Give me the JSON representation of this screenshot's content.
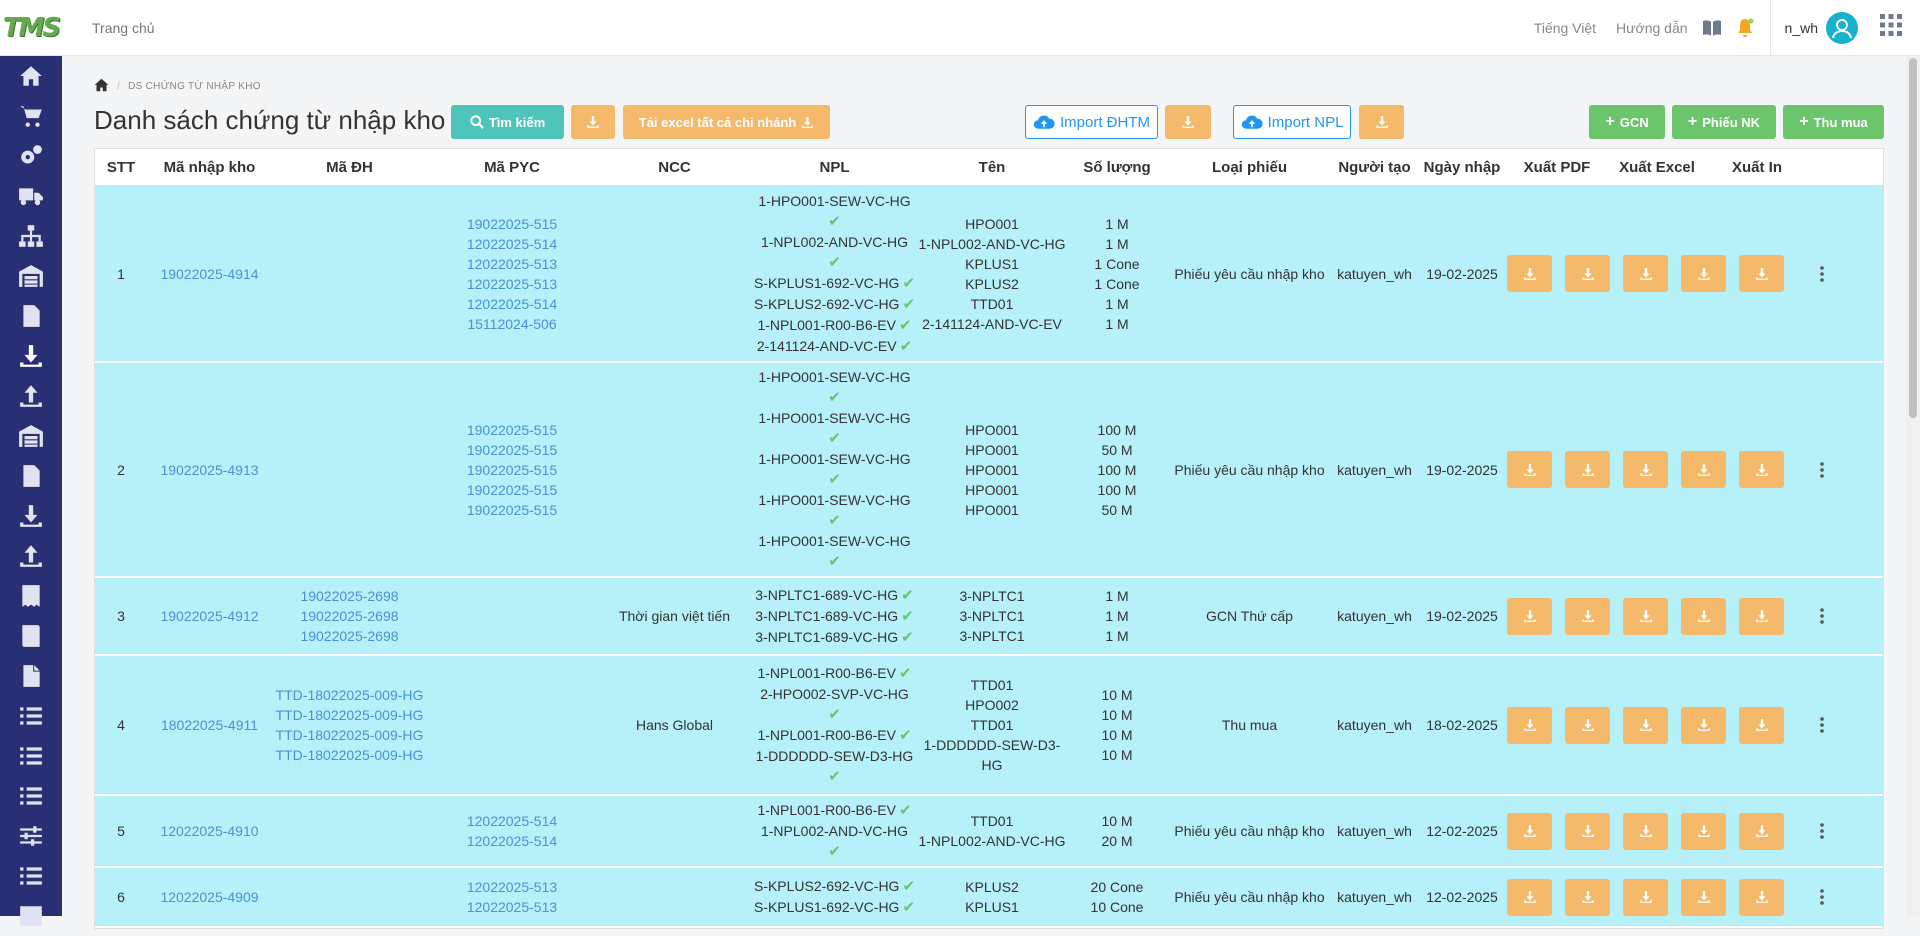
{
  "header": {
    "home": "Trang chủ",
    "language": "Tiếng Việt",
    "guide": "Hướng dẫn",
    "username": "n_wh"
  },
  "breadcrumb": {
    "current": "DS CHỨNG TỪ NHẬP KHO"
  },
  "page": {
    "title": "Danh sách chứng từ nhập kho",
    "search": "Tìm kiếm",
    "excel_all": "Tải excel tất cả chi nhánh",
    "import_dhtm": "Import ĐHTM",
    "import_npl": "Import NPL",
    "gcn": "GCN",
    "phieu_nk": "Phiếu NK",
    "thu_mua": "Thu mua"
  },
  "columns": [
    "STT",
    "Mã nhập kho",
    "Mã ĐH",
    "Mã PYC",
    "NCC",
    "NPL",
    "Tên",
    "Số lượng",
    "Loại phiếu",
    "Người tạo",
    "Ngày nhập",
    "Xuất PDF",
    "Xuất Excel",
    "Xuất In"
  ],
  "rows": [
    {
      "stt": "1",
      "ma_nk": "19022025-4914",
      "ma_dh": [],
      "ma_pyc": [
        "19022025-515",
        "12022025-514",
        "12022025-513",
        "12022025-513",
        "12022025-514",
        "15112024-506"
      ],
      "ncc": "",
      "npl": [
        [
          "1-HPO001-SEW-VC-HG",
          ""
        ],
        [
          "✔",
          ""
        ],
        [
          "1-NPL002-AND-VC-HG",
          ""
        ],
        [
          "✔",
          ""
        ],
        [
          "S-KPLUS1-692-VC-HG",
          "✔"
        ],
        [
          "S-KPLUS2-692-VC-HG",
          "✔"
        ],
        [
          "1-NPL001-R00-B6-EV",
          "✔"
        ],
        [
          "2-141124-AND-VC-EV",
          "✔"
        ]
      ],
      "ten": [
        "HPO001",
        "1-NPL002-AND-VC-HG",
        "KPLUS1",
        "KPLUS2",
        "TTD01",
        "2-141124-AND-VC-EV"
      ],
      "sl": [
        "1 M",
        "1 M",
        "1 Cone",
        "1 Cone",
        "1 M",
        "1 M"
      ],
      "loai": "Phiếu yêu cầu nhập kho",
      "nguoi": "katuyen_wh",
      "ngay": "19-02-2025"
    },
    {
      "stt": "2",
      "ma_nk": "19022025-4913",
      "ma_dh": [],
      "ma_pyc": [
        "19022025-515",
        "19022025-515",
        "19022025-515",
        "19022025-515",
        "19022025-515"
      ],
      "ncc": "",
      "npl": [
        [
          "1-HPO001-SEW-VC-HG",
          ""
        ],
        [
          "✔",
          ""
        ],
        [
          "1-HPO001-SEW-VC-HG",
          ""
        ],
        [
          "✔",
          ""
        ],
        [
          "1-HPO001-SEW-VC-HG",
          ""
        ],
        [
          "✔",
          ""
        ],
        [
          "1-HPO001-SEW-VC-HG",
          ""
        ],
        [
          "✔",
          ""
        ],
        [
          "1-HPO001-SEW-VC-HG",
          ""
        ],
        [
          "✔",
          ""
        ]
      ],
      "ten": [
        "HPO001",
        "HPO001",
        "HPO001",
        "HPO001",
        "HPO001"
      ],
      "sl": [
        "100 M",
        "50 M",
        "100 M",
        "100 M",
        "50 M"
      ],
      "loai": "Phiếu yêu cầu nhập kho",
      "nguoi": "katuyen_wh",
      "ngay": "19-02-2025"
    },
    {
      "stt": "3",
      "ma_nk": "19022025-4912",
      "ma_dh": [
        "19022025-2698",
        "19022025-2698",
        "19022025-2698"
      ],
      "ma_pyc": [],
      "ncc": "Thời gian việt tiến",
      "npl": [
        [
          "3-NPLTC1-689-VC-HG",
          "✔"
        ],
        [
          "3-NPLTC1-689-VC-HG",
          "✔"
        ],
        [
          "3-NPLTC1-689-VC-HG",
          "✔"
        ]
      ],
      "ten": [
        "3-NPLTC1",
        "3-NPLTC1",
        "3-NPLTC1"
      ],
      "sl": [
        "1 M",
        "1 M",
        "1 M"
      ],
      "loai": "GCN Thứ cấp",
      "nguoi": "katuyen_wh",
      "ngay": "19-02-2025"
    },
    {
      "stt": "4",
      "ma_nk": "18022025-4911",
      "ma_dh": [
        "TTD-18022025-009-HG",
        "TTD-18022025-009-HG",
        "TTD-18022025-009-HG",
        "TTD-18022025-009-HG"
      ],
      "ma_pyc": [],
      "ncc": "Hans Global",
      "npl": [
        [
          "1-NPL001-R00-B6-EV",
          "✔"
        ],
        [
          "2-HPO002-SVP-VC-HG",
          ""
        ],
        [
          "✔",
          ""
        ],
        [
          "1-NPL001-R00-B6-EV",
          "✔"
        ],
        [
          "1-DDDDDD-SEW-D3-HG",
          ""
        ],
        [
          "✔",
          ""
        ]
      ],
      "ten": [
        "TTD01",
        "HPO002",
        "TTD01",
        "1-DDDDDD-SEW-D3-HG"
      ],
      "sl": [
        "10 M",
        "10 M",
        "10 M",
        "10 M"
      ],
      "loai": "Thu mua",
      "nguoi": "katuyen_wh",
      "ngay": "18-02-2025"
    },
    {
      "stt": "5",
      "ma_nk": "12022025-4910",
      "ma_dh": [],
      "ma_pyc": [
        "12022025-514",
        "12022025-514"
      ],
      "ncc": "",
      "npl": [
        [
          "1-NPL001-R00-B6-EV",
          "✔"
        ],
        [
          "1-NPL002-AND-VC-HG",
          ""
        ],
        [
          "✔",
          ""
        ]
      ],
      "ten": [
        "TTD01",
        "1-NPL002-AND-VC-HG"
      ],
      "sl": [
        "10 M",
        "20 M"
      ],
      "loai": "Phiếu yêu cầu nhập kho",
      "nguoi": "katuyen_wh",
      "ngay": "12-02-2025"
    },
    {
      "stt": "6",
      "ma_nk": "12022025-4909",
      "ma_dh": [],
      "ma_pyc": [
        "12022025-513",
        "12022025-513"
      ],
      "ncc": "",
      "npl": [
        [
          "S-KPLUS2-692-VC-HG",
          "✔"
        ],
        [
          "S-KPLUS1-692-VC-HG",
          "✔"
        ]
      ],
      "ten": [
        "KPLUS2",
        "KPLUS1"
      ],
      "sl": [
        "20 Cone",
        "10 Cone"
      ],
      "loai": "Phiếu yêu cầu nhập kho",
      "nguoi": "katuyen_wh",
      "ngay": "12-02-2025"
    }
  ]
}
